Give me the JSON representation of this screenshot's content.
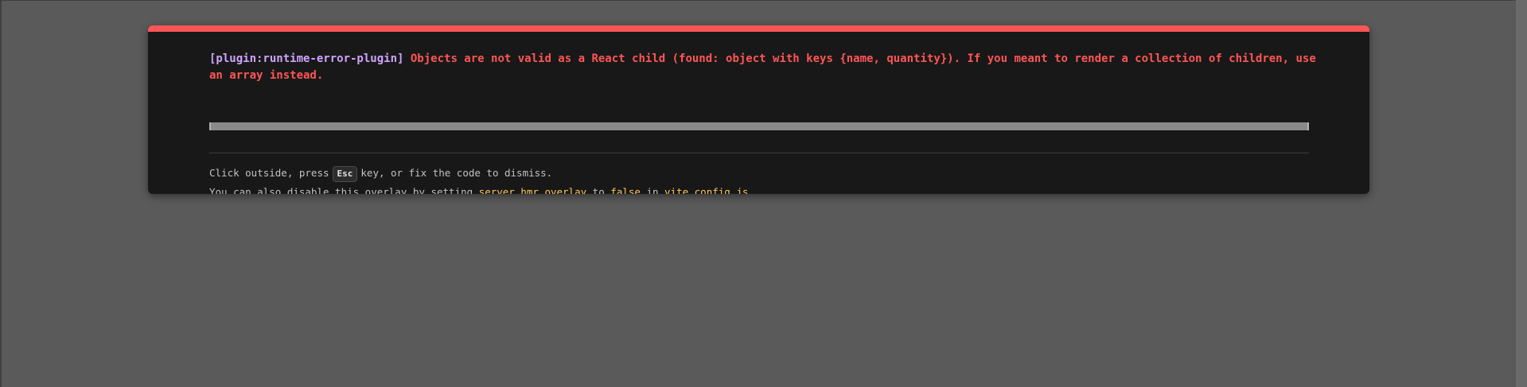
{
  "error": {
    "plugin_tag": "[plugin:runtime-error-plugin]",
    "message": "Objects are not valid as a React child (found: object with keys {name, quantity}). If you meant to render a collection of children, use an array instead."
  },
  "tip": {
    "line1_prefix": "Click outside, press",
    "key": "Esc",
    "line1_suffix": "key, or fix the code to dismiss.",
    "line2_prefix": "You can also disable this overlay by setting",
    "setting": "server.hmr.overlay",
    "to_word": "to",
    "value": "false",
    "in_word": "in",
    "file": "vite.config.js",
    "period": "."
  },
  "colors": {
    "accent_red": "#ff5555",
    "plugin_purple": "#cfa4ff",
    "code_yellow": "#ffc95c",
    "window_background": "#181818",
    "page_background": "#5a5a5a"
  }
}
